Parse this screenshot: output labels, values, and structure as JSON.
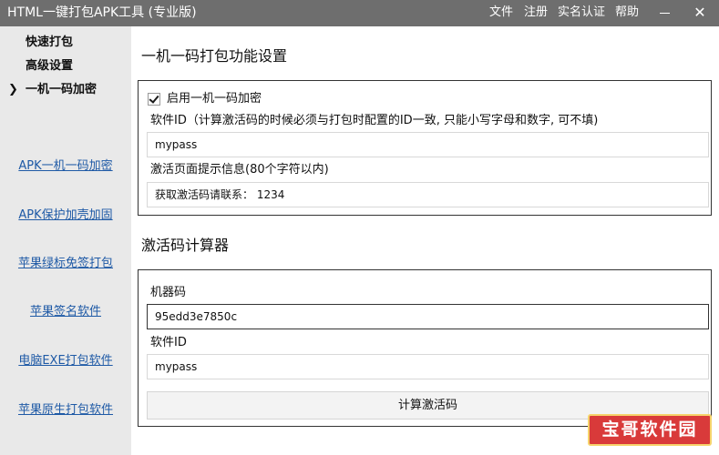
{
  "window": {
    "title": "HTML一键打包APK工具 (专业版)",
    "menu": [
      "文件",
      "注册",
      "实名认证",
      "帮助"
    ]
  },
  "sidebar": {
    "nav": [
      "快速打包",
      "高级设置",
      "一机一码加密"
    ],
    "active_marker": "❯",
    "links": [
      "APK一机一码加密",
      "APK保护加壳加固",
      "苹果绿标免签打包",
      "苹果签名软件",
      "电脑EXE打包软件",
      "苹果原生打包软件"
    ]
  },
  "settings": {
    "title": "一机一码打包功能设置",
    "enable_label": "启用一机一码加密",
    "enable_checked": true,
    "software_id_label": "软件ID（计算激活码的时候必须与打包时配置的ID一致, 只能小写字母和数字, 可不填)",
    "software_id_value": "mypass",
    "activation_tip_label": "激活页面提示信息(80个字符以内)",
    "activation_tip_value": "获取激活码请联系： 1234"
  },
  "calculator": {
    "title": "激活码计算器",
    "machine_code_label": "机器码",
    "machine_code_value": "95edd3e7850c",
    "software_id_label": "软件ID",
    "software_id_value": "mypass",
    "compute_button": "计算激活码"
  },
  "watermark": "宝哥软件园"
}
